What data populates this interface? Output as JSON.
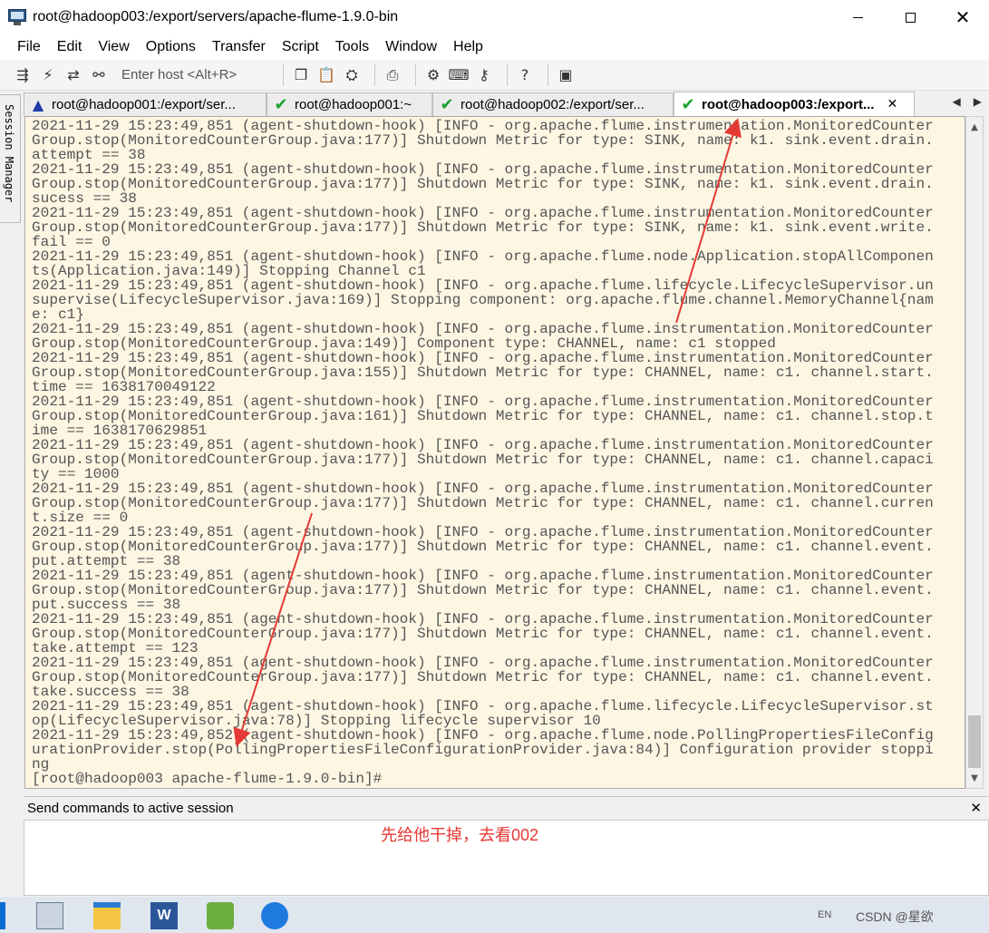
{
  "window": {
    "title": "root@hadoop003:/export/servers/apache-flume-1.9.0-bin"
  },
  "menu": [
    "File",
    "Edit",
    "View",
    "Options",
    "Transfer",
    "Script",
    "Tools",
    "Window",
    "Help"
  ],
  "toolbar": {
    "host_placeholder": "Enter host <Alt+R>"
  },
  "session_manager_label": "Session Manager",
  "tabs": [
    {
      "label": "root@hadoop001:/export/ser...",
      "status": "warning",
      "active": false
    },
    {
      "label": "root@hadoop001:~",
      "status": "connected",
      "active": false
    },
    {
      "label": "root@hadoop002:/export/ser...",
      "status": "connected",
      "active": false
    },
    {
      "label": "root@hadoop003:/export...",
      "status": "connected",
      "active": true
    }
  ],
  "terminal": {
    "lines": [
      "2021-11-29 15:23:49,851 (agent-shutdown-hook) [INFO - org.apache.flume.instrumentation.MonitoredCounter",
      "Group.stop(MonitoredCounterGroup.java:177)] Shutdown Metric for type: SINK, name: k1. sink.event.drain.",
      "attempt == 38",
      "2021-11-29 15:23:49,851 (agent-shutdown-hook) [INFO - org.apache.flume.instrumentation.MonitoredCounter",
      "Group.stop(MonitoredCounterGroup.java:177)] Shutdown Metric for type: SINK, name: k1. sink.event.drain.",
      "sucess == 38",
      "2021-11-29 15:23:49,851 (agent-shutdown-hook) [INFO - org.apache.flume.instrumentation.MonitoredCounter",
      "Group.stop(MonitoredCounterGroup.java:177)] Shutdown Metric for type: SINK, name: k1. sink.event.write.",
      "fail == 0",
      "2021-11-29 15:23:49,851 (agent-shutdown-hook) [INFO - org.apache.flume.node.Application.stopAllComponen",
      "ts(Application.java:149)] Stopping Channel c1",
      "2021-11-29 15:23:49,851 (agent-shutdown-hook) [INFO - org.apache.flume.lifecycle.LifecycleSupervisor.un",
      "supervise(LifecycleSupervisor.java:169)] Stopping component: org.apache.flume.channel.MemoryChannel{nam",
      "e: c1}",
      "2021-11-29 15:23:49,851 (agent-shutdown-hook) [INFO - org.apache.flume.instrumentation.MonitoredCounter",
      "Group.stop(MonitoredCounterGroup.java:149)] Component type: CHANNEL, name: c1 stopped",
      "2021-11-29 15:23:49,851 (agent-shutdown-hook) [INFO - org.apache.flume.instrumentation.MonitoredCounter",
      "Group.stop(MonitoredCounterGroup.java:155)] Shutdown Metric for type: CHANNEL, name: c1. channel.start.",
      "time == 1638170049122",
      "2021-11-29 15:23:49,851 (agent-shutdown-hook) [INFO - org.apache.flume.instrumentation.MonitoredCounter",
      "Group.stop(MonitoredCounterGroup.java:161)] Shutdown Metric for type: CHANNEL, name: c1. channel.stop.t",
      "ime == 1638170629851",
      "2021-11-29 15:23:49,851 (agent-shutdown-hook) [INFO - org.apache.flume.instrumentation.MonitoredCounter",
      "Group.stop(MonitoredCounterGroup.java:177)] Shutdown Metric for type: CHANNEL, name: c1. channel.capaci",
      "ty == 1000",
      "2021-11-29 15:23:49,851 (agent-shutdown-hook) [INFO - org.apache.flume.instrumentation.MonitoredCounter",
      "Group.stop(MonitoredCounterGroup.java:177)] Shutdown Metric for type: CHANNEL, name: c1. channel.curren",
      "t.size == 0",
      "2021-11-29 15:23:49,851 (agent-shutdown-hook) [INFO - org.apache.flume.instrumentation.MonitoredCounter",
      "Group.stop(MonitoredCounterGroup.java:177)] Shutdown Metric for type: CHANNEL, name: c1. channel.event.",
      "put.attempt == 38",
      "2021-11-29 15:23:49,851 (agent-shutdown-hook) [INFO - org.apache.flume.instrumentation.MonitoredCounter",
      "Group.stop(MonitoredCounterGroup.java:177)] Shutdown Metric for type: CHANNEL, name: c1. channel.event.",
      "put.success == 38",
      "2021-11-29 15:23:49,851 (agent-shutdown-hook) [INFO - org.apache.flume.instrumentation.MonitoredCounter",
      "Group.stop(MonitoredCounterGroup.java:177)] Shutdown Metric for type: CHANNEL, name: c1. channel.event.",
      "take.attempt == 123",
      "2021-11-29 15:23:49,851 (agent-shutdown-hook) [INFO - org.apache.flume.instrumentation.MonitoredCounter",
      "Group.stop(MonitoredCounterGroup.java:177)] Shutdown Metric for type: CHANNEL, name: c1. channel.event.",
      "take.success == 38",
      "2021-11-29 15:23:49,851 (agent-shutdown-hook) [INFO - org.apache.flume.lifecycle.LifecycleSupervisor.st",
      "op(LifecycleSupervisor.java:78)] Stopping lifecycle supervisor 10",
      "2021-11-29 15:23:49,852 (agent-shutdown-hook) [INFO - org.apache.flume.node.PollingPropertiesFileConfig",
      "urationProvider.stop(PollingPropertiesFileConfigurationProvider.java:84)] Configuration provider stoppi",
      "ng",
      "[root@hadoop003 apache-flume-1.9.0-bin]#"
    ]
  },
  "send_panel": {
    "title": "Send commands to active session"
  },
  "annotation": {
    "text": "先给他干掉，去看002",
    "color": "#e53935"
  },
  "taskbar": {
    "lang": "EN",
    "watermark": "CSDN @星欲"
  }
}
